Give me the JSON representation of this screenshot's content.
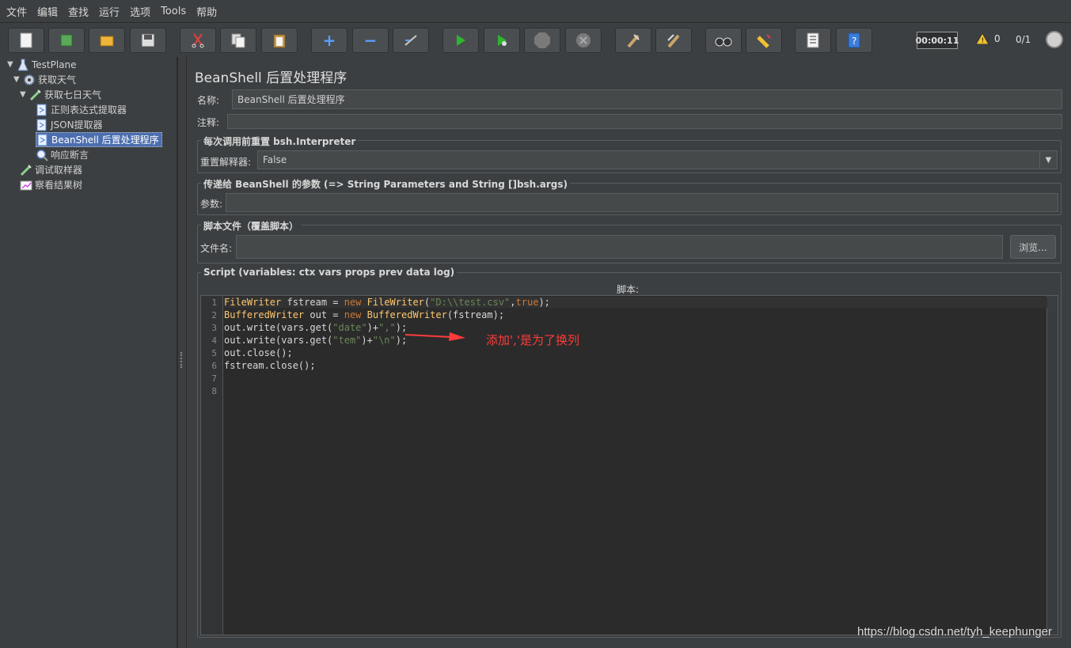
{
  "menu": [
    "文件",
    "编辑",
    "查找",
    "运行",
    "选项",
    "Tools",
    "帮助"
  ],
  "toolbar": {
    "buttons": [
      "new-icon",
      "templates-icon",
      "open-icon",
      "save-icon",
      "cut-icon",
      "copy-icon",
      "paste-icon",
      "expand-icon",
      "collapse-icon",
      "toggle-icon",
      "start-icon",
      "start-no-pause-icon",
      "stop-icon",
      "shutdown-icon",
      "clear-icon",
      "clear-all-icon",
      "search-icon",
      "reset-search-icon",
      "function-helper-icon",
      "help-icon"
    ],
    "timer": "00:00:11",
    "warnings": "0",
    "threads": "0/1"
  },
  "tree": [
    {
      "label": "TestPlane",
      "icon": "flask-icon",
      "indent": 0,
      "arrow": "▼"
    },
    {
      "label": "获取天气",
      "icon": "gear-icon",
      "indent": 1,
      "arrow": "▼"
    },
    {
      "label": "获取七日天气",
      "icon": "pipette-icon",
      "indent": 2,
      "arrow": "▼"
    },
    {
      "label": "正则表达式提取器",
      "icon": "document-icon",
      "indent": 3,
      "arrow": ""
    },
    {
      "label": "JSON提取器",
      "icon": "document-icon",
      "indent": 3,
      "arrow": ""
    },
    {
      "label": "BeanShell 后置处理程序",
      "icon": "document-icon",
      "indent": 3,
      "arrow": "",
      "selected": true
    },
    {
      "label": "响应断言",
      "icon": "magnifier-icon",
      "indent": 3,
      "arrow": ""
    },
    {
      "label": "调试取样器",
      "icon": "pipette-icon",
      "indent": 2,
      "arrow": ""
    },
    {
      "label": "察看结果树",
      "icon": "graph-icon",
      "indent": 2,
      "arrow": ""
    }
  ],
  "panel": {
    "title": "BeanShell 后置处理程序",
    "name_label": "名称:",
    "name_value": "BeanShell 后置处理程序",
    "comment_label": "注释:",
    "comment_value": "",
    "reset_legend": "每次调用前重置 bsh.Interpreter",
    "reset_label": "重置解释器:",
    "reset_value": "False",
    "params_legend": "传递给 BeanShell 的参数 (=> String Parameters and String []bsh.args)",
    "params_label": "参数:",
    "params_value": "",
    "file_legend": "脚本文件（覆盖脚本）",
    "file_label": "文件名:",
    "file_value": "",
    "browse_label": "浏览...",
    "script_legend": "Script (variables: ctx vars props prev data log)",
    "script_label": "脚本:"
  },
  "code_lines": [
    "FileWriter fstream = new FileWriter(\"D:\\\\test.csv\",true);",
    "BufferedWriter out = new BufferedWriter(fstream);",
    "out.write(vars.get(\"date\")+\",\");",
    "out.write(vars.get(\"tem\")+\"\\n\");",
    "out.close();",
    "fstream.close();",
    "",
    ""
  ],
  "line_numbers": [
    "1",
    "2",
    "3",
    "4",
    "5",
    "6",
    "7",
    "8"
  ],
  "annotation": "添加','是为了换列",
  "watermark": "https://blog.csdn.net/tyh_keephunger",
  "colors": {
    "accent": "#4b6eaf",
    "annotation": "#ff3b3b",
    "keyword": "#cc7832",
    "string": "#6a8759"
  }
}
